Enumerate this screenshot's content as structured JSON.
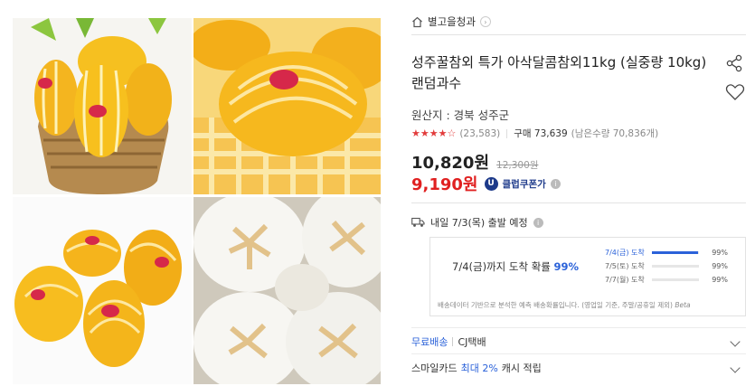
{
  "store": {
    "name": "별고을청과",
    "chevron": "›"
  },
  "product": {
    "title": "성주꿀참외 특가 아삭달콤참외11kg (실중량 10kg)랜덤과수",
    "origin": "원산지 : 경북 성주군",
    "rating_stars": "★★★★☆",
    "review_count": "(23,583)",
    "purchase_label": "구매 73,639",
    "stock_label": "(남은수량 70,836개)",
    "price": "10,820원",
    "original_price": "12,300원",
    "coupon_price": "9,190원",
    "coupon_badge": "U",
    "coupon_label": "클럽쿠폰가",
    "info": "i"
  },
  "shipping": {
    "label": "내일 7/3(목) 출발 예정",
    "info": "i",
    "forecast_prefix": "7/4(금)까지 도착 확률 ",
    "forecast_pct": "99%",
    "forecast_rows": [
      {
        "date": "7/4(금) 도착",
        "pct_text": "99%",
        "fill": 0.99,
        "active": true
      },
      {
        "date": "7/5(토) 도착",
        "pct_text": "99%",
        "fill": 0,
        "active": false
      },
      {
        "date": "7/7(월) 도착",
        "pct_text": "99%",
        "fill": 0,
        "active": false
      }
    ],
    "note": "배송데이터 기반으로 분석한 예측 배송확률입니다. (영업일 기준, 주말/공휴일 제외)",
    "beta": "Beta"
  },
  "delivery": {
    "free_label": "무료배송",
    "courier": "CJ택배"
  },
  "card": {
    "prefix": "스마일카드",
    "rate": "최대 2%",
    "suffix": "캐시 적립"
  },
  "icons": {
    "store": "store-icon",
    "share": "share-icon",
    "heart": "heart-icon",
    "truck": "truck-icon"
  },
  "colors": {
    "accent_blue": "#2b62d9",
    "price_red": "#e02020",
    "star_red": "#e23c3c",
    "coupon_navy": "#1d3a8a"
  }
}
